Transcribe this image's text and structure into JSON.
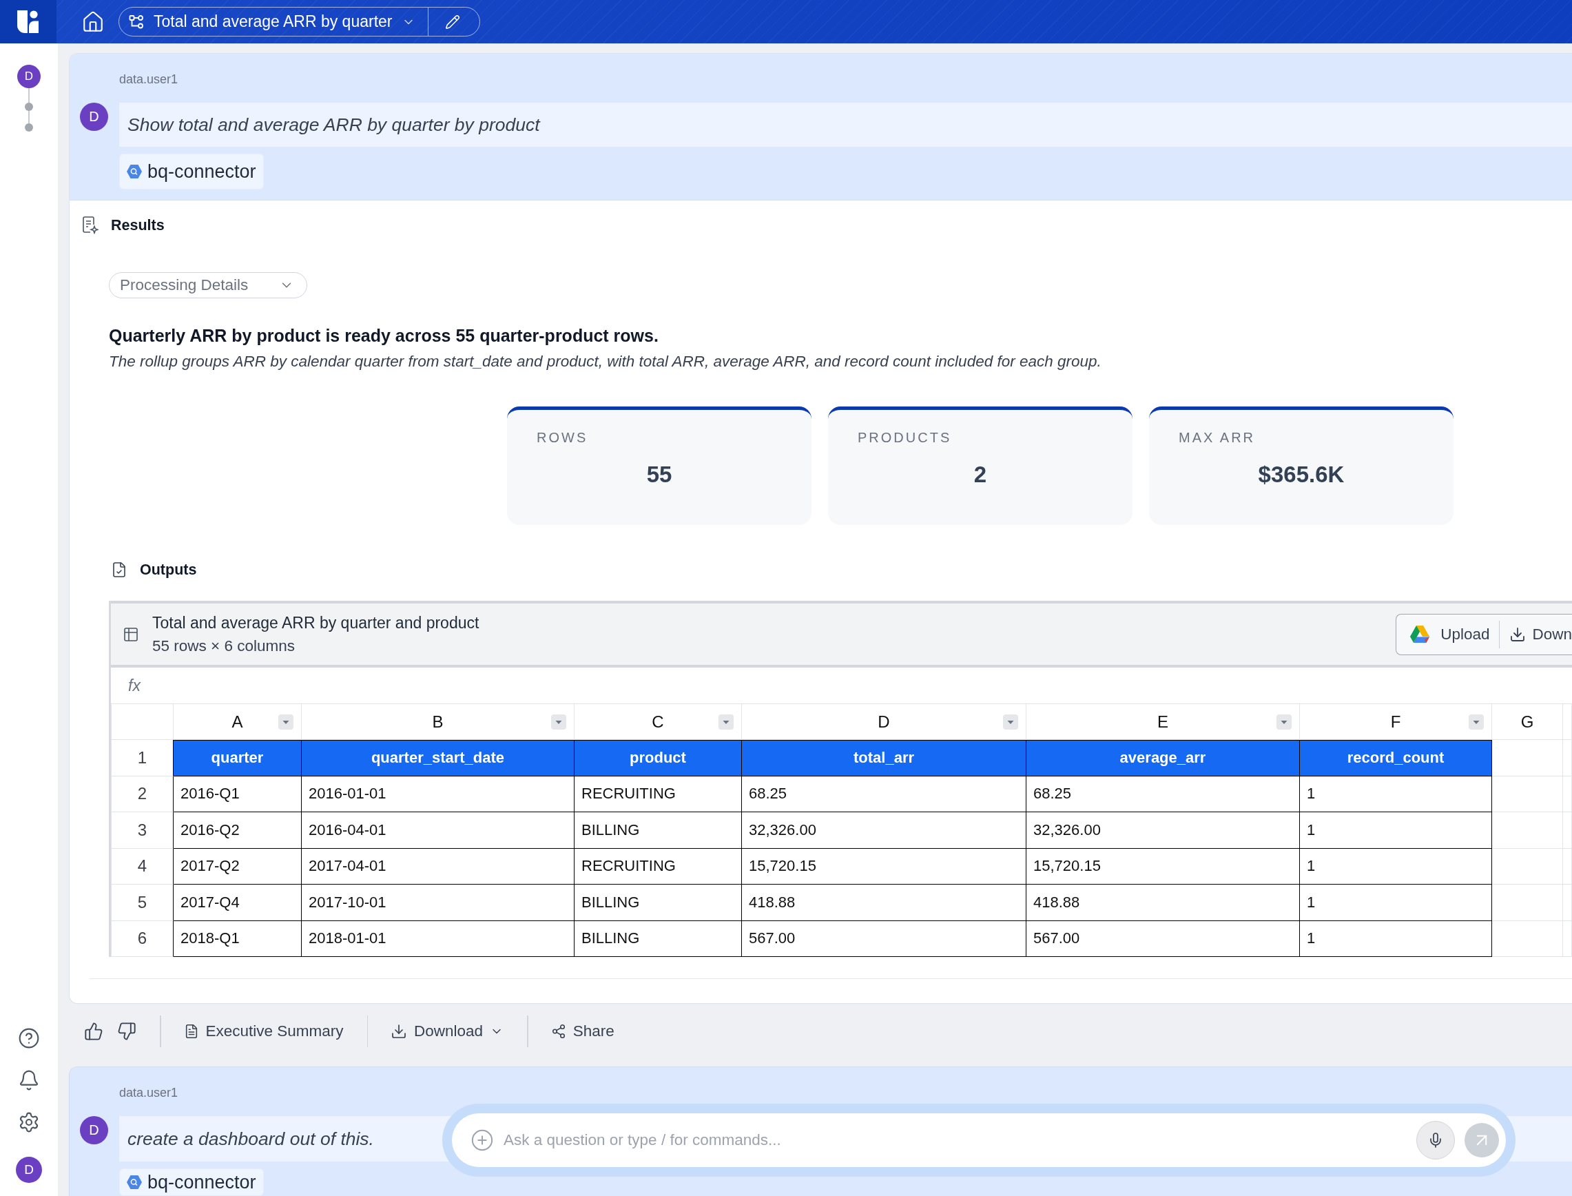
{
  "top_bar": {
    "title": "Total and average ARR by quarter"
  },
  "rail": {
    "avatar": "D",
    "profile_avatar": "D"
  },
  "prompt": {
    "user": "data.user1",
    "avatar": "D",
    "text": "Show total and average ARR by quarter by product",
    "connector": "bq-connector"
  },
  "results": {
    "title": "Results",
    "processing": {
      "label": "Processing Details",
      "expanded": false
    },
    "headline": "Quarterly ARR by product is ready across 55 quarter-product rows.",
    "summary": "The rollup groups ARR by calendar quarter from start_date and product, with total ARR, average ARR, and record count included for each group.",
    "stats": [
      {
        "label": "ROWS",
        "value": "55"
      },
      {
        "label": "PRODUCTS",
        "value": "2"
      },
      {
        "label": "MAX ARR",
        "value": "$365.6K"
      }
    ],
    "outputs": {
      "title": "Outputs",
      "table": {
        "title": "Total and average ARR by quarter and product",
        "subtitle": "55 rows × 6 columns",
        "buttons": [
          {
            "kind": "upload",
            "label": "Upload"
          },
          {
            "kind": "download",
            "label": "Down"
          }
        ],
        "formula_label": "fx",
        "column_letters": [
          "A",
          "B",
          "C",
          "D",
          "E",
          "F",
          "G"
        ],
        "row_numbers": [
          "1",
          "2",
          "3",
          "4",
          "5",
          "6"
        ],
        "columns": [
          "quarter",
          "quarter_start_date",
          "product",
          "total_arr",
          "average_arr",
          "record_count"
        ],
        "rows": [
          [
            "2016-Q1",
            "2016-01-01",
            "RECRUITING",
            "68.25",
            "68.25",
            "1"
          ],
          [
            "2016-Q2",
            "2016-04-01",
            "BILLING",
            "32,326.00",
            "32,326.00",
            "1"
          ],
          [
            "2017-Q2",
            "2017-04-01",
            "RECRUITING",
            "15,720.15",
            "15,720.15",
            "1"
          ],
          [
            "2017-Q4",
            "2017-10-01",
            "BILLING",
            "418.88",
            "418.88",
            "1"
          ],
          [
            "2018-Q1",
            "2018-01-01",
            "BILLING",
            "567.00",
            "567.00",
            "1"
          ]
        ]
      }
    }
  },
  "actions": [
    {
      "kind": "document",
      "label": "Executive Summary",
      "has_menu": false
    },
    {
      "kind": "download",
      "label": "Download",
      "has_menu": true
    },
    {
      "kind": "share",
      "label": "Share",
      "has_menu": false
    }
  ],
  "followup": {
    "user": "data.user1",
    "avatar": "D",
    "text": "create a dashboard out of this.",
    "connector": "bq-connector"
  },
  "composer": {
    "placeholder": "Ask a question or type / for commands...",
    "send_disabled": true
  }
}
